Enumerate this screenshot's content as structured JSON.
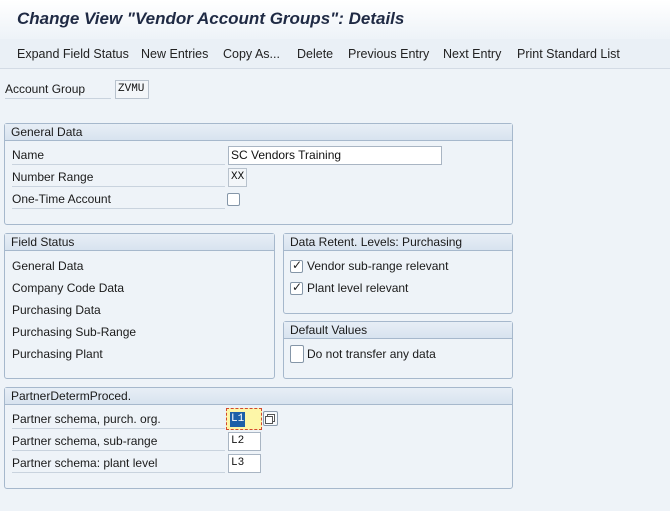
{
  "header": {
    "title": "Change View \"Vendor Account Groups\": Details"
  },
  "toolbar": {
    "expand_field_status": "Expand Field Status",
    "new_entries": "New Entries",
    "copy_as": "Copy As...",
    "delete": "Delete",
    "previous_entry": "Previous Entry",
    "next_entry": "Next Entry",
    "print_standard_list": "Print Standard List"
  },
  "account_group": {
    "label": "Account Group",
    "value": "ZVMU"
  },
  "general_data": {
    "heading": "General Data",
    "name_label": "Name",
    "name_value": "SC Vendors Training",
    "number_range_label": "Number Range",
    "number_range_value": "XX",
    "one_time_label": "One-Time Account",
    "one_time_checked": false
  },
  "field_status": {
    "heading": "Field Status",
    "items": [
      "General Data",
      "Company Code Data",
      "Purchasing Data",
      "Purchasing Sub-Range",
      "Purchasing Plant"
    ]
  },
  "retention": {
    "heading": "Data Retent. Levels: Purchasing",
    "vendor_subrange_label": "Vendor sub-range relevant",
    "vendor_subrange_checked": true,
    "plant_level_label": "Plant level relevant",
    "plant_level_checked": true
  },
  "default_values": {
    "heading": "Default Values",
    "no_transfer_label": "Do not transfer any data",
    "no_transfer_checked": false
  },
  "partner": {
    "heading": "PartnerDetermProced.",
    "purch_org_label": "Partner schema, purch. org.",
    "purch_org_value": "L1",
    "sub_range_label": "Partner schema, sub-range",
    "sub_range_value": "L2",
    "plant_level_label": "Partner schema: plant level",
    "plant_level_value": "L3"
  },
  "colors": {
    "background": "#eef3f8",
    "group_border": "#a6b8cc",
    "title": "#1f2a44",
    "focus_highlight": "#fdf6a8",
    "focus_border": "#d2472e"
  }
}
